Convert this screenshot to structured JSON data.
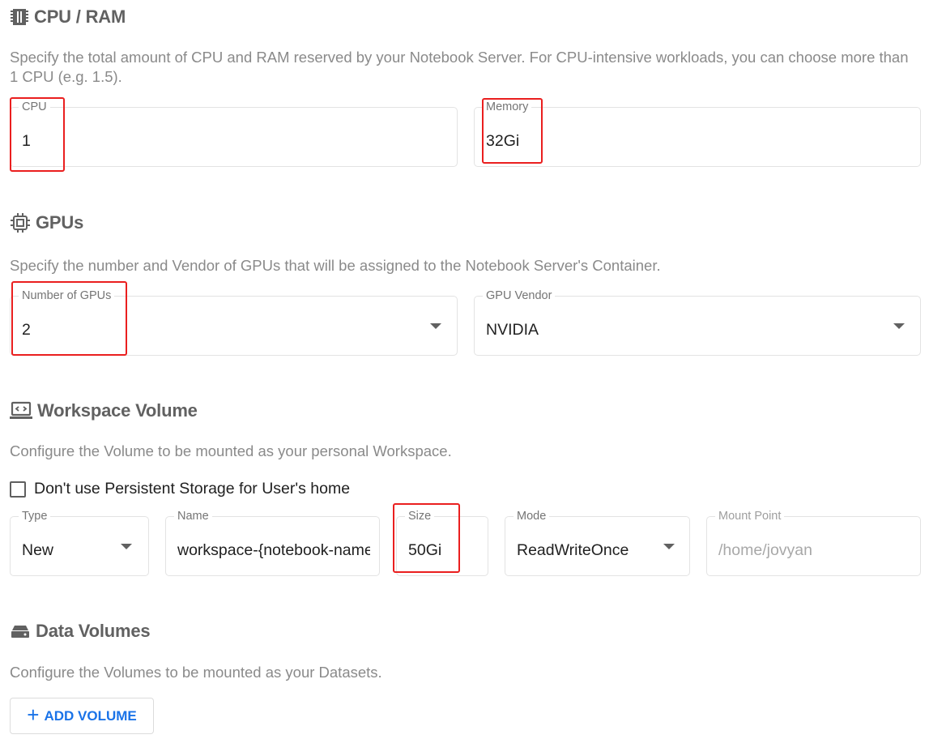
{
  "cpu_ram": {
    "title": "CPU / RAM",
    "description": "Specify the total amount of CPU and RAM reserved by your Notebook Server. For CPU-intensive workloads, you can choose more than 1 CPU (e.g. 1.5).",
    "cpu": {
      "label": "CPU",
      "value": "1"
    },
    "memory": {
      "label": "Memory",
      "value": "32Gi"
    }
  },
  "gpus": {
    "title": "GPUs",
    "description": "Specify the number and Vendor of GPUs that will be assigned to the Notebook Server's Container.",
    "number": {
      "label": "Number of GPUs",
      "value": "2"
    },
    "vendor": {
      "label": "GPU Vendor",
      "value": "NVIDIA"
    }
  },
  "workspace": {
    "title": "Workspace Volume",
    "description": "Configure the Volume to be mounted as your personal Workspace.",
    "checkbox_label": "Don't use Persistent Storage for User's home",
    "type": {
      "label": "Type",
      "value": "New"
    },
    "name": {
      "label": "Name",
      "value": "workspace-{notebook-name}"
    },
    "size": {
      "label": "Size",
      "value": "50Gi"
    },
    "mode": {
      "label": "Mode",
      "value": "ReadWriteOnce"
    },
    "mount_point": {
      "label": "Mount Point",
      "value": "/home/jovyan"
    }
  },
  "data_volumes": {
    "title": "Data Volumes",
    "description": "Configure the Volumes to be mounted as your Datasets.",
    "add_button": "ADD VOLUME"
  },
  "colors": {
    "accent": "#1a73e8",
    "highlight": "#ea1f1f",
    "title": "#616161",
    "description": "#8a8a8a"
  }
}
